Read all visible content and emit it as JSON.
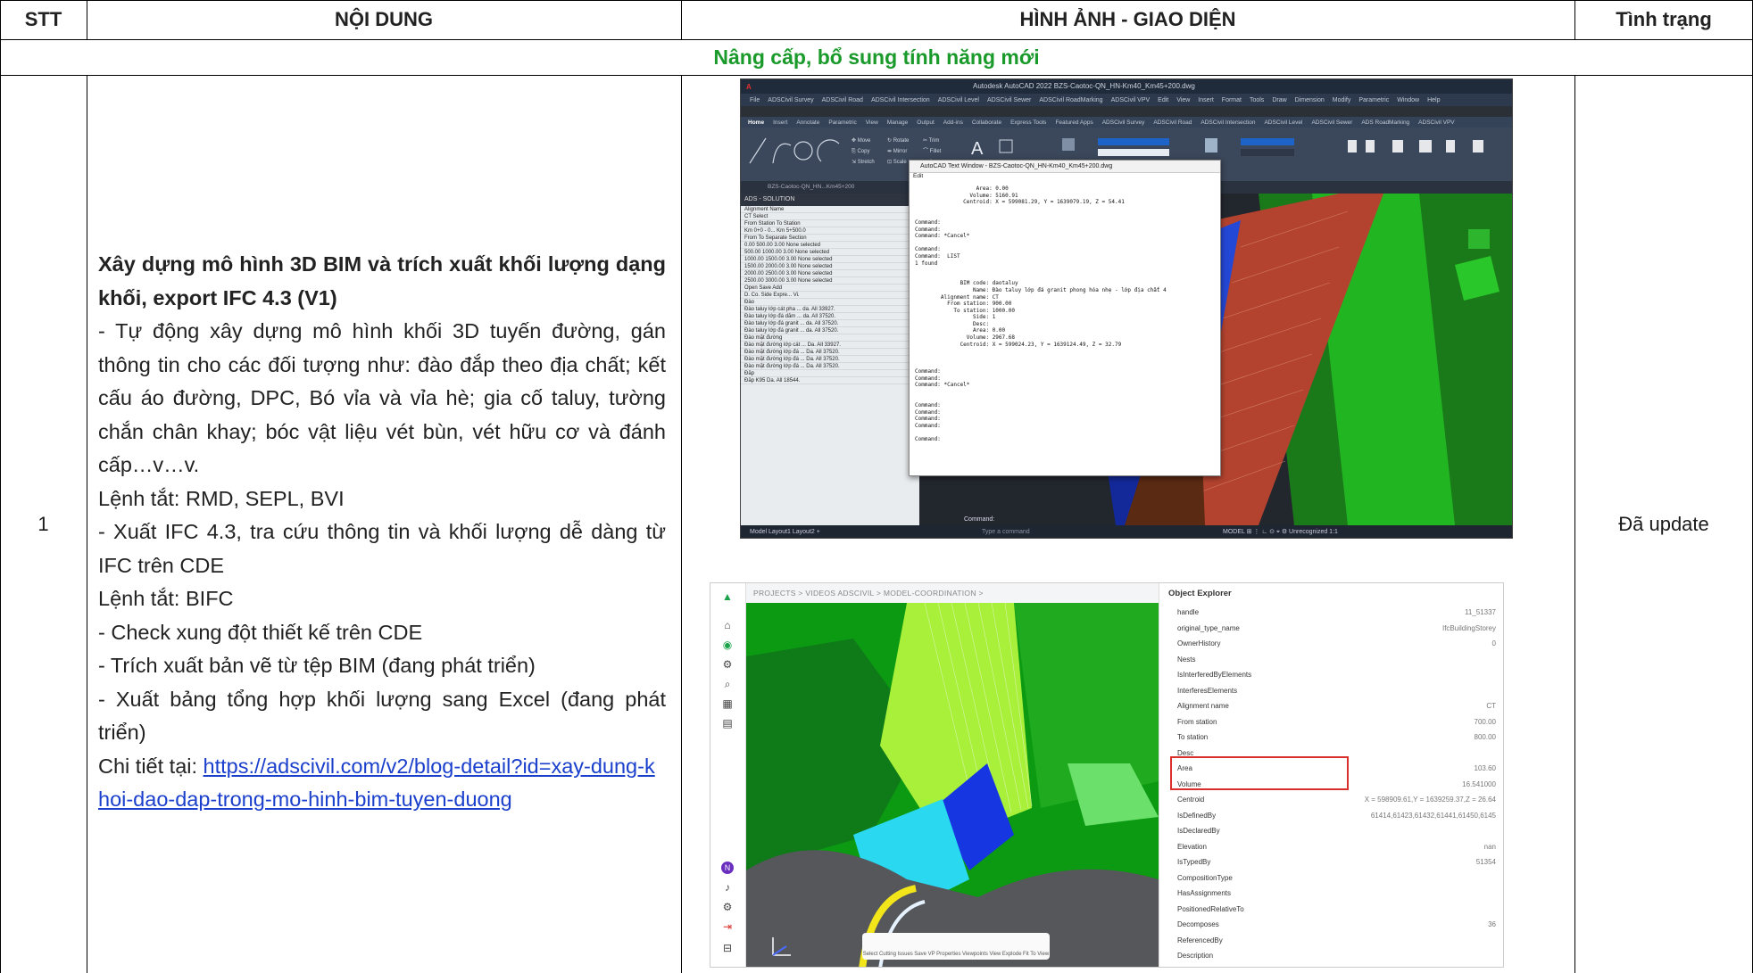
{
  "header": {
    "stt": "STT",
    "noi_dung": "NỘI DUNG",
    "hinh_anh": "HÌNH ẢNH - GIAO DIỆN",
    "tinh_trang": "Tình trạng"
  },
  "section": {
    "title": "Nâng cấp, bổ sung tính năng mới",
    "title_color": "#1a9a2a"
  },
  "row": {
    "stt": "1",
    "status": "Đã update",
    "title": "Xây dựng mô hình 3D BIM và trích xuất khối lượng dạng khối, export IFC 4.3 (V1)",
    "lines": [
      "- Tự động xây dựng mô hình khối 3D tuyến đường, gán thông tin cho các đối tượng như: đào đắp theo địa chất;  kết cấu áo đường, DPC, Bó vỉa và vỉa hè; gia cố taluy, tường chắn chân khay;  bóc vật liệu vét bùn, vét hữu cơ và đánh cấp…v…v.",
      "Lệnh tắt: RMD, SEPL, BVI",
      "- Xuất IFC 4.3, tra cứu thông tin và khối lượng dễ dàng từ IFC trên CDE",
      "Lệnh tắt: BIFC",
      "- Check xung đột thiết kế trên CDE",
      "- Trích xuất bản vẽ từ tệp BIM  (đang phát triển)",
      "- Xuất bảng tổng hợp khối lượng sang Excel (đang phát triển)"
    ],
    "detail_prefix": "Chi tiết tại: ",
    "detail_link": "https://adscivil.com/v2/blog-detail?id=xay-dung-khoi-dao-dap-trong-mo-hinh-bim-tuyen-duong"
  },
  "autocad": {
    "window_title": "Autodesk AutoCAD 2022  BZS-Caotoc-QN_HN-Km40_Km45+200.dwg",
    "menu": [
      "File",
      "ADSCivil Survey",
      "ADSCivil Road",
      "ADSCivil Intersection",
      "ADSCivil Level",
      "ADSCivil Sewer",
      "ADSCivil RoadMarking",
      "ADSCivil VPV",
      "Edit",
      "View",
      "Insert",
      "Format",
      "Tools",
      "Draw",
      "Dimension",
      "Modify",
      "Parametric",
      "Window",
      "Help"
    ],
    "ribbon_tabs": [
      "Home",
      "Insert",
      "Annotate",
      "Parametric",
      "View",
      "Manage",
      "Output",
      "Add-ins",
      "Collaborate",
      "Express Tools",
      "Featured Apps",
      "ADSCivil Survey",
      "ADSCivil Road",
      "ADSCivil Intersection",
      "ADSCivil Level",
      "ADSCivil Sewer",
      "ADS RoadMarking",
      "ADSCivil VPV"
    ],
    "file_tab": "BZS-Caotoc-QN_HN...Km45+200",
    "panel_title": "ADS - SOLUTION",
    "panel_rows": [
      "Alignment Name",
      "CT                Select",
      "From Station        To Station",
      "Km 0+0 - 0...   Km 5+500.0",
      "From    To     Separate   Section",
      "0.00    500.00   3.00   None selected",
      "500.00  1000.00  3.00   None selected",
      "1000.00 1500.00  3.00   None selected",
      "1500.00 2000.00  3.00   None selected",
      "2000.00 2500.00  3.00   None selected",
      "2500.00 3000.00  3.00   None selected",
      "Open   Save        Add",
      "D.  Co.  Side  Expre...  Vi.",
      "Đào",
      "Đào taluy lớp cát pha ... da.  All  33927.",
      "Đào taluy lớp đá dăm ... da.  All  37520.",
      "Đào taluy lớp đá granit ... da. All 37520.",
      "Đào taluy lớp đá granit ... da. All 37520.",
      "Đào mặt đường",
      "Đào mặt đường lớp cát ... Da. All 33927.",
      "Đào mặt đường lớp đá ... Da. All 37520.",
      "Đào mặt đường lớp đá ... Da. All 37520.",
      "Đào mặt đường lớp đá ... Da. All 37520.",
      "Đắp",
      "Đắp K95        Da. All 18544."
    ],
    "text_window_title": "AutoCAD Text Window - BZS-Caotoc-QN_HN-Km40_Km45+200.dwg",
    "text_window_menu": "Edit",
    "text_window_body": "                   Area: 0.00\n                 Volume: 5160.91\n               Centroid: X = 599081.29, Y = 1639079.19, Z = 54.41\n\n\nCommand:\nCommand:\nCommand: *Cancel*\n\nCommand:\nCommand:  LIST\n1 found\n\n\n              BIM code: daotaluy\n                  Name: Đào taluy lớp đá granit phong hóa nhẹ - lớp địa chất 4\n        Alignment name: CT\n          From station: 900.00\n            To station: 1000.00\n                  Side: 1\n                  Desc:\n                  Area: 0.00\n                Volume: 2967.68\n              Centroid: X = 599024.23, Y = 1639124.49, Z = 32.79\n\n\n\nCommand:\nCommand:\nCommand: *Cancel*\n\n\nCommand:\nCommand:\nCommand:\nCommand:\n\nCommand:",
    "command_line": "Command:",
    "command_placeholder": "Type a command",
    "status_tabs": "Model   Layout1   Layout2   +",
    "status_right": "MODEL  ⊞  ⋮  ∟  ⊙  ⌖  ⚙  Unrecognized  1:1"
  },
  "cde": {
    "breadcrumb": "PROJECTS  >  VIDEOS ADSCIVIL  >  MODEL-COORDINATION  >",
    "toolbar": [
      "Select",
      "Cutting",
      "Issues",
      "Save VP",
      "Properties",
      "Viewpoints",
      "View",
      "Explode",
      "Fit To View"
    ],
    "explorer_title": "Object Explorer",
    "properties": [
      {
        "k": "handle",
        "v": "11_51337"
      },
      {
        "k": "original_type_name",
        "v": "IfcBuildingStorey"
      },
      {
        "k": "OwnerHistory",
        "v": "0"
      },
      {
        "k": "Nests",
        "v": ""
      },
      {
        "k": "IsInterferedByElements",
        "v": ""
      },
      {
        "k": "InterferesElements",
        "v": ""
      },
      {
        "k": "Alignment name",
        "v": "CT"
      },
      {
        "k": "From station",
        "v": "700.00"
      },
      {
        "k": "To station",
        "v": "800.00"
      },
      {
        "k": "Desc",
        "v": ""
      },
      {
        "k": "Area",
        "v": "103.60"
      },
      {
        "k": "Volume",
        "v": "16.541000"
      },
      {
        "k": "Centroid",
        "v": "X = 598909.61,Y = 1639259.37,Z = 26.64"
      },
      {
        "k": "IsDefinedBy",
        "v": "61414,61423,61432,61441,61450,6145"
      },
      {
        "k": "IsDeclaredBy",
        "v": ""
      },
      {
        "k": "Elevation",
        "v": "nan"
      },
      {
        "k": "IsTypedBy",
        "v": "51354"
      },
      {
        "k": "CompositionType",
        "v": ""
      },
      {
        "k": "HasAssignments",
        "v": ""
      },
      {
        "k": "PositionedRelativeTo",
        "v": ""
      },
      {
        "k": "Decomposes",
        "v": "36"
      },
      {
        "k": "ReferencedBy",
        "v": ""
      },
      {
        "k": "Description",
        "v": ""
      }
    ]
  }
}
